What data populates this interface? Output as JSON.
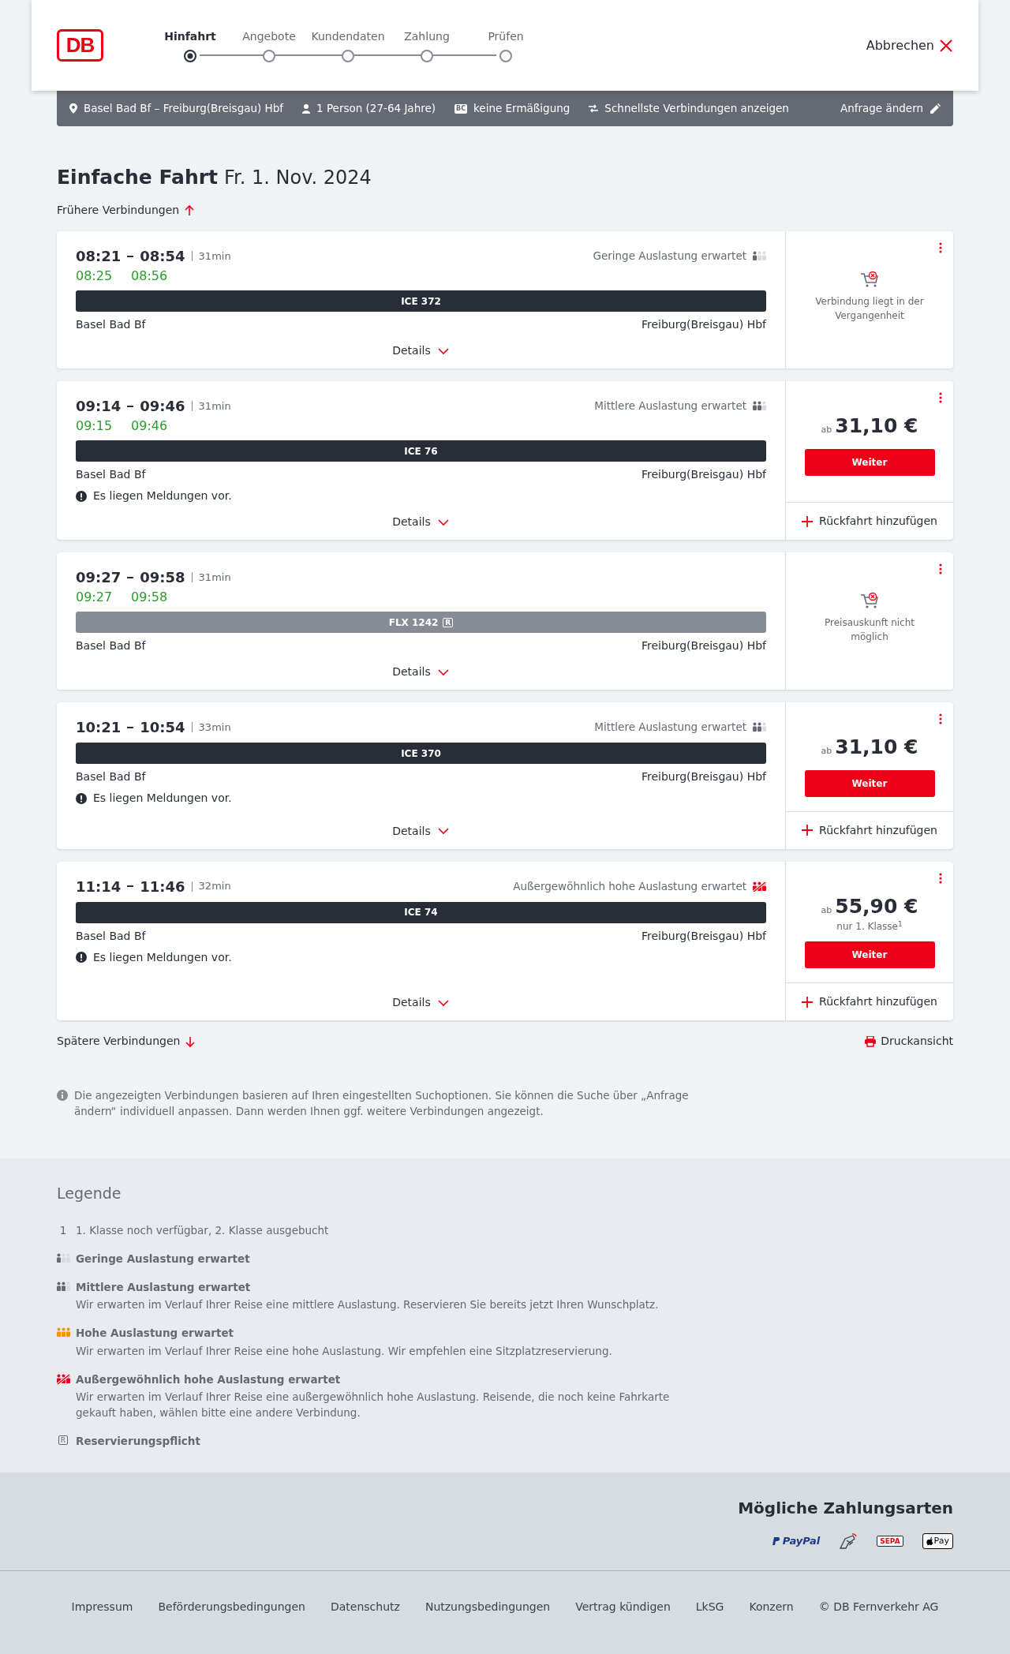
{
  "header": {
    "logo": "DB",
    "cancel": "Abbrechen"
  },
  "steps": [
    {
      "label": "Hinfahrt",
      "selected": true
    },
    {
      "label": "Angebote",
      "selected": false
    },
    {
      "label": "Kundendaten",
      "selected": false
    },
    {
      "label": "Zahlung",
      "selected": false
    },
    {
      "label": "Prüfen",
      "selected": false
    }
  ],
  "summary": {
    "route": "Basel Bad Bf – Freiburg(Breisgau) Hbf",
    "passengers": "1 Person (27-64 Jahre)",
    "discount_badge": "BC",
    "discount": "keine Ermäßigung",
    "option": "Schnellste Verbindungen anzeigen",
    "change": "Anfrage ändern"
  },
  "title": "Einfache Fahrt",
  "date": "Fr. 1. Nov. 2024",
  "earlier": "Frühere Verbindungen",
  "connections": [
    {
      "departure": "08:21",
      "arrival": "08:54",
      "duration": "31min",
      "rt_departure": "08:25",
      "rt_arrival": "08:56",
      "occupancy": {
        "kind": "low",
        "text": "Geringe Auslastung erwartet"
      },
      "train": {
        "kind": "db",
        "name": "ICE 372",
        "reservation_required": false
      },
      "from": "Basel Bad Bf",
      "to": "Freiburg(Breisgau) Hbf",
      "details": "Details",
      "offer": {
        "kind": "unavailable",
        "text": "Verbindung liegt in der Vergangenheit"
      }
    },
    {
      "departure": "09:14",
      "arrival": "09:46",
      "duration": "31min",
      "rt_departure": "09:15",
      "rt_arrival": "09:46",
      "occupancy": {
        "kind": "medium",
        "text": "Mittlere Auslastung erwartet"
      },
      "train": {
        "kind": "db",
        "name": "ICE 76",
        "reservation_required": false
      },
      "from": "Basel Bad Bf",
      "to": "Freiburg(Breisgau) Hbf",
      "message": "Es liegen Meldungen vor.",
      "details": "Details",
      "offer": {
        "kind": "price",
        "prefix": "ab",
        "price": "31,10 €",
        "button": "Weiter",
        "return_link": "Rückfahrt hinzufügen"
      }
    },
    {
      "departure": "09:27",
      "arrival": "09:58",
      "duration": "31min",
      "rt_departure": "09:27",
      "rt_arrival": "09:58",
      "train": {
        "kind": "other",
        "name": "FLX 1242",
        "reservation_required": true,
        "reservation_mark": "R"
      },
      "from": "Basel Bad Bf",
      "to": "Freiburg(Breisgau) Hbf",
      "details": "Details",
      "offer": {
        "kind": "unavailable",
        "text": "Preisauskunft nicht möglich"
      }
    },
    {
      "departure": "10:21",
      "arrival": "10:54",
      "duration": "33min",
      "occupancy": {
        "kind": "medium",
        "text": "Mittlere Auslastung erwartet"
      },
      "train": {
        "kind": "db",
        "name": "ICE 370",
        "reservation_required": false
      },
      "from": "Basel Bad Bf",
      "to": "Freiburg(Breisgau) Hbf",
      "message": "Es liegen Meldungen vor.",
      "details": "Details",
      "offer": {
        "kind": "price",
        "prefix": "ab",
        "price": "31,10 €",
        "button": "Weiter",
        "return_link": "Rückfahrt hinzufügen"
      }
    },
    {
      "departure": "11:14",
      "arrival": "11:46",
      "duration": "32min",
      "occupancy": {
        "kind": "extreme",
        "text": "Außergewöhnlich hohe Auslastung erwartet"
      },
      "train": {
        "kind": "db",
        "name": "ICE 74",
        "reservation_required": false
      },
      "from": "Basel Bad Bf",
      "to": "Freiburg(Breisgau) Hbf",
      "message": "Es liegen Meldungen vor.",
      "details": "Details",
      "offer": {
        "kind": "price",
        "prefix": "ab",
        "price": "55,90 €",
        "note": "nur 1. Klasse$^{1}$",
        "button": "Weiter",
        "return_link": "Rückfahrt hinzufügen"
      }
    }
  ],
  "later": "Spätere Verbindungen",
  "print": "Druckansicht",
  "info": "Die angezeigten Verbindungen basieren auf Ihren eingestellten Suchoptionen. Sie können die Suche über „Anfrage ändern“ individuell anpassen. Dann werden Ihnen ggf. weitere Verbindungen angezeigt.",
  "legend": {
    "title": "Legende",
    "items": [
      {
        "kind": "footnote",
        "marker": "1",
        "title": "1. Klasse noch verfügbar, 2. Klasse ausgebucht"
      },
      {
        "kind": "low",
        "title": "Geringe Auslastung erwartet"
      },
      {
        "kind": "medium",
        "title": "Mittlere Auslastung erwartet",
        "text": "Wir erwarten im Verlauf Ihrer Reise eine mittlere Auslastung. Reservieren Sie bereits jetzt Ihren Wunschplatz."
      },
      {
        "kind": "high",
        "title": "Hohe Auslastung erwartet",
        "text": "Wir erwarten im Verlauf Ihrer Reise eine hohe Auslastung. Wir empfehlen eine Sitzplatzreservierung."
      },
      {
        "kind": "extreme",
        "title": "Außergewöhnlich hohe Auslastung erwartet",
        "text": "Wir erwarten im Verlauf Ihrer Reise eine außergewöhnlich hohe Auslastung. Reisende, die noch keine Fahrkarte gekauft haben, wählen bitte eine andere Verbindung."
      },
      {
        "kind": "reservation",
        "marker": "R",
        "title": "Reservierungspflicht"
      }
    ]
  },
  "payment": {
    "title": "Mögliche Zahlungsarten",
    "methods": [
      {
        "kind": "paypal",
        "label": "PayPal"
      },
      {
        "kind": "card"
      },
      {
        "kind": "sepa",
        "label": "SEPA"
      },
      {
        "kind": "applepay",
        "label": "Pay"
      }
    ]
  },
  "footer_links": [
    "Impressum",
    "Beförderungsbedingungen",
    "Datenschutz",
    "Nutzungsbedingungen",
    "Vertrag kündigen",
    "LkSG",
    "Konzern",
    "© DB Fernverkehr AG"
  ]
}
